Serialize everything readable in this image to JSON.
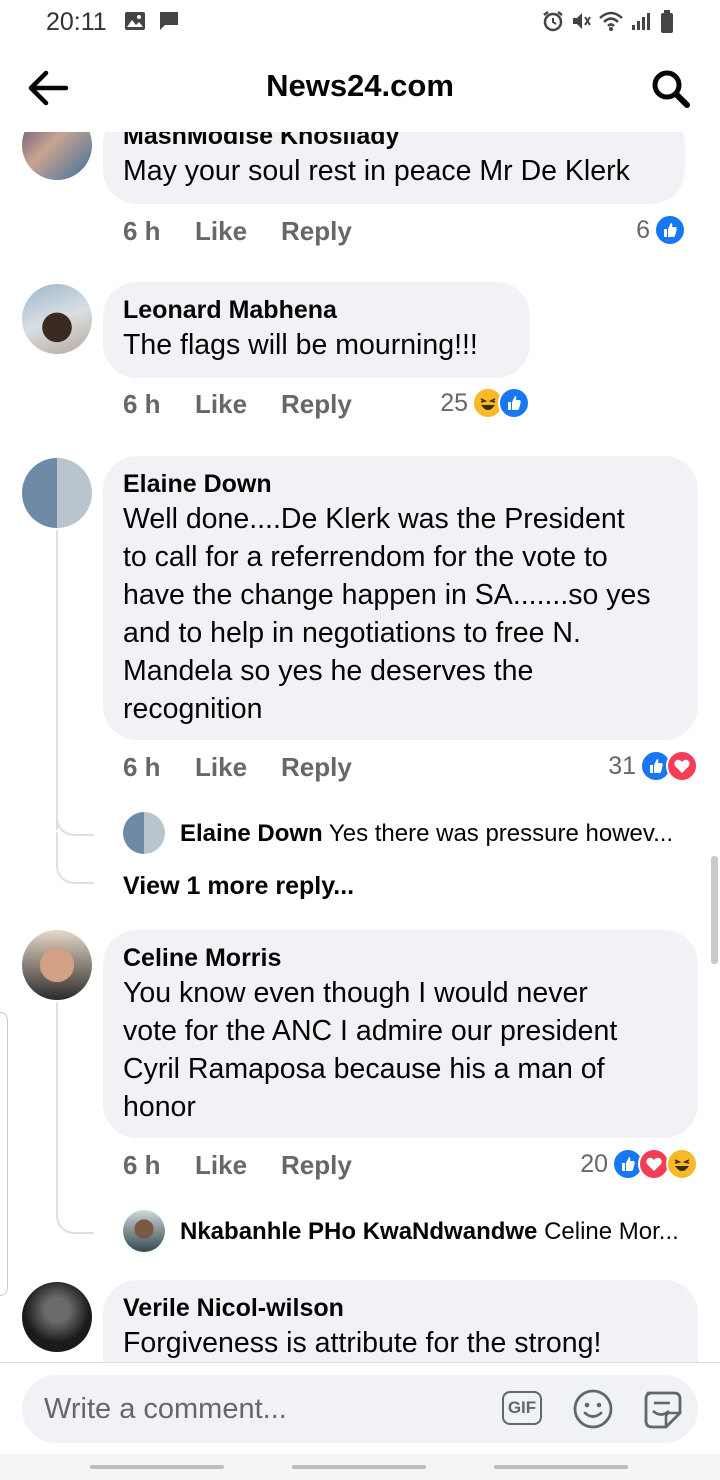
{
  "status_bar": {
    "time": "20:11"
  },
  "header": {
    "title": "News24.com"
  },
  "comments": [
    {
      "author": "MashModise Khosiiady",
      "text": "May your soul rest in peace Mr De Klerk",
      "time": "6 h",
      "like": "Like",
      "reply": "Reply",
      "reaction_count": "6",
      "reactions": [
        "like"
      ]
    },
    {
      "author": "Leonard Mabhena",
      "text": "The flags will be mourning!!!",
      "time": "6 h",
      "like": "Like",
      "reply": "Reply",
      "reaction_count": "25",
      "reactions": [
        "haha",
        "like"
      ]
    },
    {
      "author": "Elaine Down",
      "text_lines": [
        "Well done....De Klerk was the President",
        "to call for a referrendom for the vote to",
        "have the change happen in SA.......so yes",
        "and to help in negotiations to free N.",
        "Mandela so yes he deserves the",
        "recognition"
      ],
      "time": "6 h",
      "like": "Like",
      "reply": "Reply",
      "reaction_count": "31",
      "reactions": [
        "like",
        "love"
      ],
      "reply_preview": {
        "author": "Elaine Down",
        "text": "Yes there was pressure howev..."
      },
      "view_more": "View 1 more reply..."
    },
    {
      "author": "Celine Morris",
      "text_lines": [
        "You know even though I would never",
        "vote for the ANC I admire our president",
        "Cyril Ramaposa because his a man of",
        "honor"
      ],
      "time": "6 h",
      "like": "Like",
      "reply": "Reply",
      "reaction_count": "20",
      "reactions": [
        "like",
        "love",
        "haha"
      ],
      "reply_preview": {
        "author": "Nkabanhle PHo KwaNdwandwe",
        "text": "Celine Mor..."
      }
    },
    {
      "author": "Verile Nicol-wilson",
      "text": "Forgiveness is attribute for the strong!"
    }
  ],
  "composer": {
    "placeholder": "Write a comment...",
    "gif_label": "GIF"
  },
  "colors": {
    "like": "#1877f2",
    "love": "#f33e58",
    "haha": "#f7b928",
    "bubble": "#f0f2f5",
    "meta": "#65676b"
  }
}
